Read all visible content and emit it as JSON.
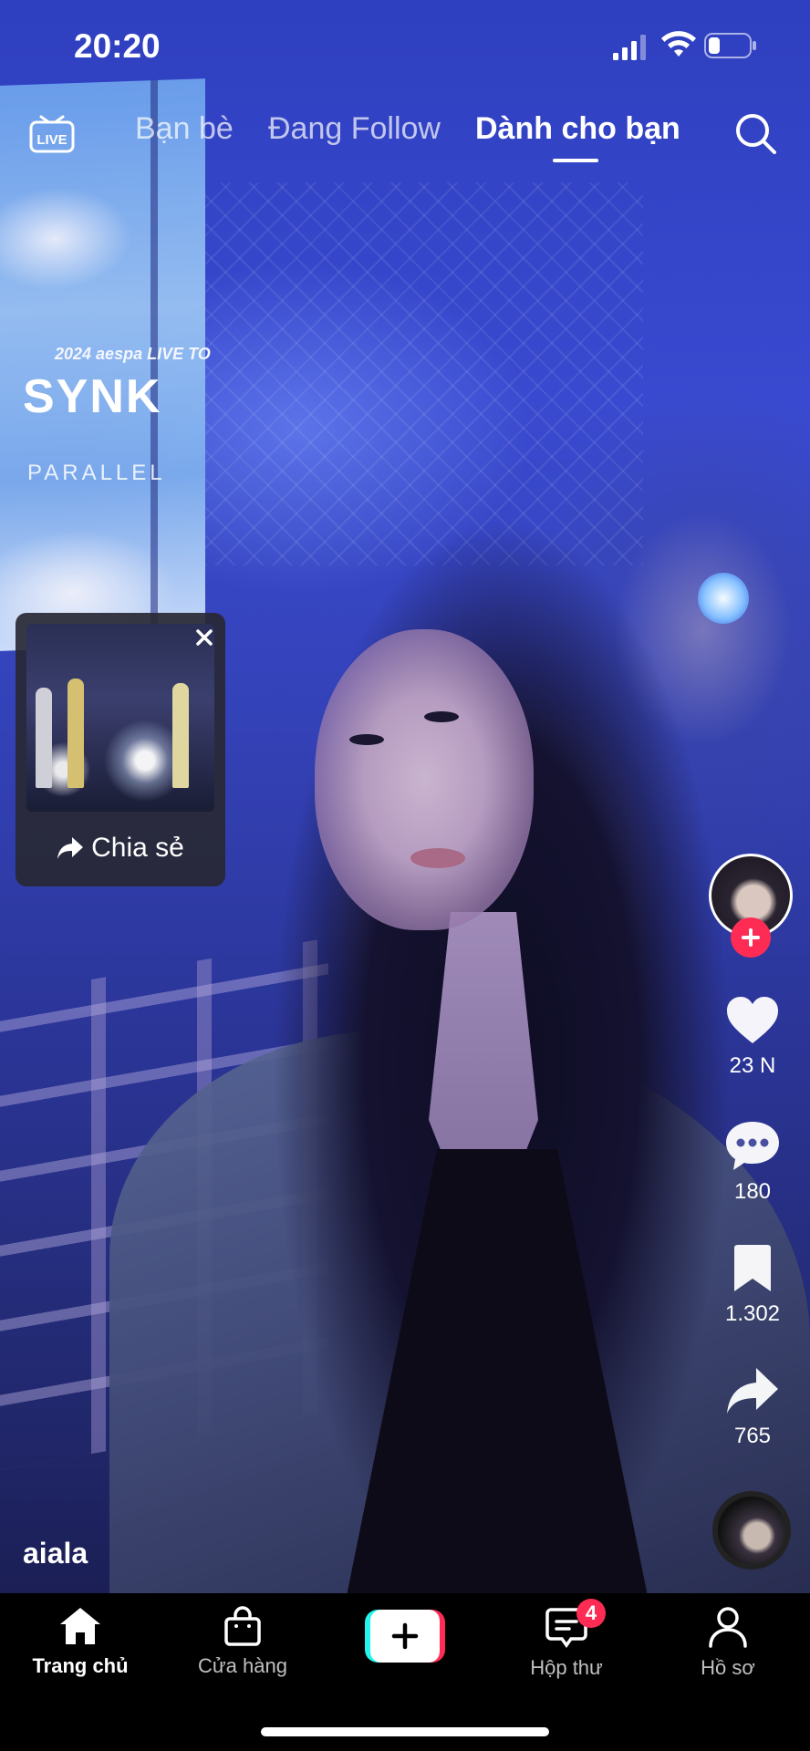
{
  "status_bar": {
    "time": "20:20"
  },
  "top_nav": {
    "live_label": "LIVE",
    "tabs": [
      {
        "label": "Bạn bè"
      },
      {
        "label": "Đang Follow"
      },
      {
        "label": "Dành cho bạn",
        "active": true
      }
    ]
  },
  "video": {
    "banner_line1": "2024 aespa LIVE TO",
    "banner_line2": "SYNK",
    "banner_line3": "PARALLEL"
  },
  "share_popup": {
    "share_label": "Chia sẻ"
  },
  "actions": {
    "likes": "23 N",
    "comments": "180",
    "saves": "1.302",
    "shares": "765"
  },
  "post": {
    "username": "aiala"
  },
  "bottom_nav": {
    "items": [
      {
        "label": "Trang chủ",
        "icon": "home-icon",
        "active": true
      },
      {
        "label": "Cửa hàng",
        "icon": "shop-bag-icon"
      },
      {
        "label": "",
        "icon": "create-plus-icon"
      },
      {
        "label": "Hộp thư",
        "icon": "inbox-icon",
        "badge": "4"
      },
      {
        "label": "Hồ sơ",
        "icon": "profile-icon"
      }
    ]
  },
  "colors": {
    "accent": "#fe2c55",
    "accent_cyan": "#25f4ee",
    "background": "#000000"
  }
}
